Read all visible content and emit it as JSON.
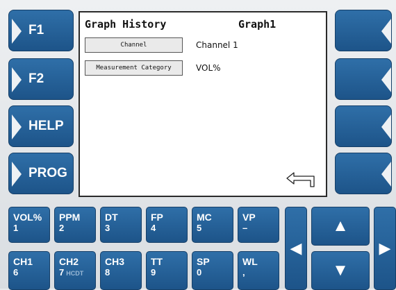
{
  "softkeys": {
    "left": [
      "F1",
      "F2",
      "HELP",
      "PROG"
    ],
    "right": [
      "",
      "",
      "",
      ""
    ]
  },
  "screen": {
    "title": "Graph History",
    "graph_name": "Graph1",
    "rows": [
      {
        "button": "Channel",
        "value": "Channel 1"
      },
      {
        "button": "Measurement Category",
        "value": "VOL%"
      }
    ],
    "back_icon": "return-arrow-icon"
  },
  "keypad": {
    "row1": [
      {
        "top": "VOL%",
        "bottom": "1",
        "sub": ""
      },
      {
        "top": "PPM",
        "bottom": "2",
        "sub": ""
      },
      {
        "top": "DT",
        "bottom": "3",
        "sub": ""
      },
      {
        "top": "FP",
        "bottom": "4",
        "sub": ""
      },
      {
        "top": "MC",
        "bottom": "5",
        "sub": ""
      },
      {
        "top": "VP",
        "bottom": "–",
        "sub": ""
      }
    ],
    "row2": [
      {
        "top": "CH1",
        "bottom": "6",
        "sub": ""
      },
      {
        "top": "CH2",
        "bottom": "7",
        "sub": "HCDT"
      },
      {
        "top": "CH3",
        "bottom": "8",
        "sub": ""
      },
      {
        "top": "TT",
        "bottom": "9",
        "sub": ""
      },
      {
        "top": "SP",
        "bottom": "0",
        "sub": ""
      },
      {
        "top": "WL",
        "bottom": ",",
        "sub": ""
      }
    ],
    "arrows": {
      "left": "◀",
      "up": "▲",
      "down": "▼",
      "right": "▶"
    }
  },
  "colors": {
    "key_blue": "#1d5489",
    "screen_bg": "#ffffff"
  }
}
